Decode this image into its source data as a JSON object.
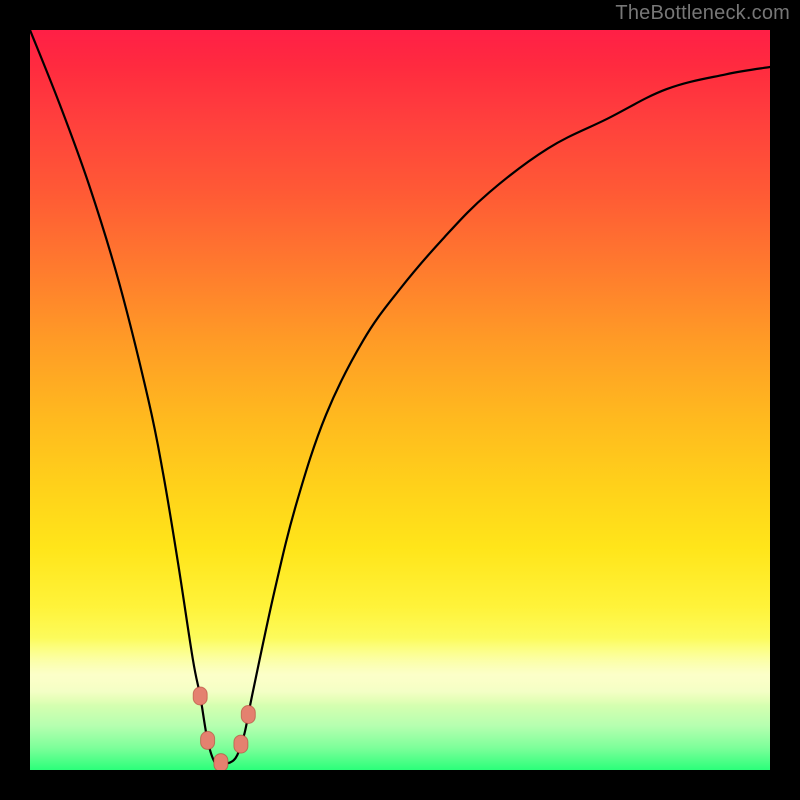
{
  "watermark": "TheBottleneck.com",
  "chart_data": {
    "type": "line",
    "title": "",
    "xlabel": "",
    "ylabel": "",
    "x_range": [
      0,
      100
    ],
    "y_range": [
      0,
      100
    ],
    "grid": false,
    "legend": false,
    "series": [
      {
        "name": "bottleneck-curve",
        "x": [
          0,
          4,
          8,
          12,
          16,
          18,
          20,
          22,
          23,
          24,
          25,
          26,
          27,
          28,
          29,
          30,
          33,
          36,
          40,
          45,
          50,
          56,
          62,
          70,
          78,
          86,
          94,
          100
        ],
        "y": [
          100,
          90,
          79,
          66,
          50,
          40,
          28,
          15,
          10,
          4,
          1,
          1,
          1,
          2,
          5,
          10,
          24,
          36,
          48,
          58,
          65,
          72,
          78,
          84,
          88,
          92,
          94,
          95
        ]
      }
    ],
    "markers": [
      {
        "name": "point-a",
        "x": 23.0,
        "y": 10.0
      },
      {
        "name": "point-b",
        "x": 24.0,
        "y": 4.0
      },
      {
        "name": "point-c",
        "x": 25.8,
        "y": 1.0
      },
      {
        "name": "point-d",
        "x": 28.5,
        "y": 3.5
      },
      {
        "name": "point-e",
        "x": 29.5,
        "y": 7.5
      }
    ],
    "colors": {
      "curve": "#000000",
      "marker": "#e4816f",
      "gradient_top": "#ff1f46",
      "gradient_mid": "#ffd21a",
      "gradient_bottom": "#2bff7a",
      "background": "#000000"
    }
  }
}
